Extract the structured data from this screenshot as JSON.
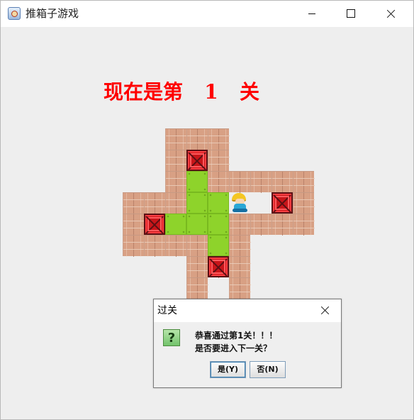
{
  "window": {
    "title": "推箱子游戏"
  },
  "game": {
    "level_prefix": "现在是第",
    "level_number": "1",
    "level_suffix": "关",
    "board": {
      "walls": [
        [
          0,
          0
        ],
        [
          1,
          0
        ],
        [
          2,
          0
        ],
        [
          0,
          1
        ],
        [
          2,
          1
        ],
        [
          0,
          2
        ],
        [
          2,
          2
        ],
        [
          3,
          2
        ],
        [
          4,
          2
        ],
        [
          5,
          2
        ],
        [
          6,
          2
        ],
        [
          -2,
          3
        ],
        [
          -1,
          3
        ],
        [
          0,
          3
        ],
        [
          6,
          3
        ],
        [
          -2,
          4
        ],
        [
          0,
          4
        ],
        [
          3,
          4
        ],
        [
          4,
          4
        ],
        [
          5,
          4
        ],
        [
          6,
          4
        ],
        [
          -2,
          5
        ],
        [
          -1,
          5
        ],
        [
          0,
          5
        ],
        [
          1,
          5
        ],
        [
          3,
          5
        ],
        [
          1,
          6
        ],
        [
          2,
          6
        ],
        [
          3,
          6
        ],
        [
          1,
          7
        ],
        [
          3,
          7
        ],
        [
          1,
          8
        ],
        [
          2,
          8
        ],
        [
          3,
          8
        ]
      ],
      "goals": [
        [
          1,
          2
        ],
        [
          1,
          3
        ],
        [
          2,
          3
        ],
        [
          0,
          4
        ],
        [
          1,
          4
        ],
        [
          2,
          4
        ],
        [
          2,
          5
        ]
      ],
      "boxes": [
        [
          1,
          1
        ],
        [
          5,
          3
        ],
        [
          -1,
          4
        ],
        [
          2,
          6
        ]
      ],
      "worker": [
        3,
        3
      ]
    }
  },
  "dialog": {
    "title": "过关",
    "line1": "恭喜通过第1关！！！",
    "line2": "是否要进入下一关？",
    "yes_label": "是(Y)",
    "no_label": "否(N)",
    "icon": "question-icon"
  }
}
